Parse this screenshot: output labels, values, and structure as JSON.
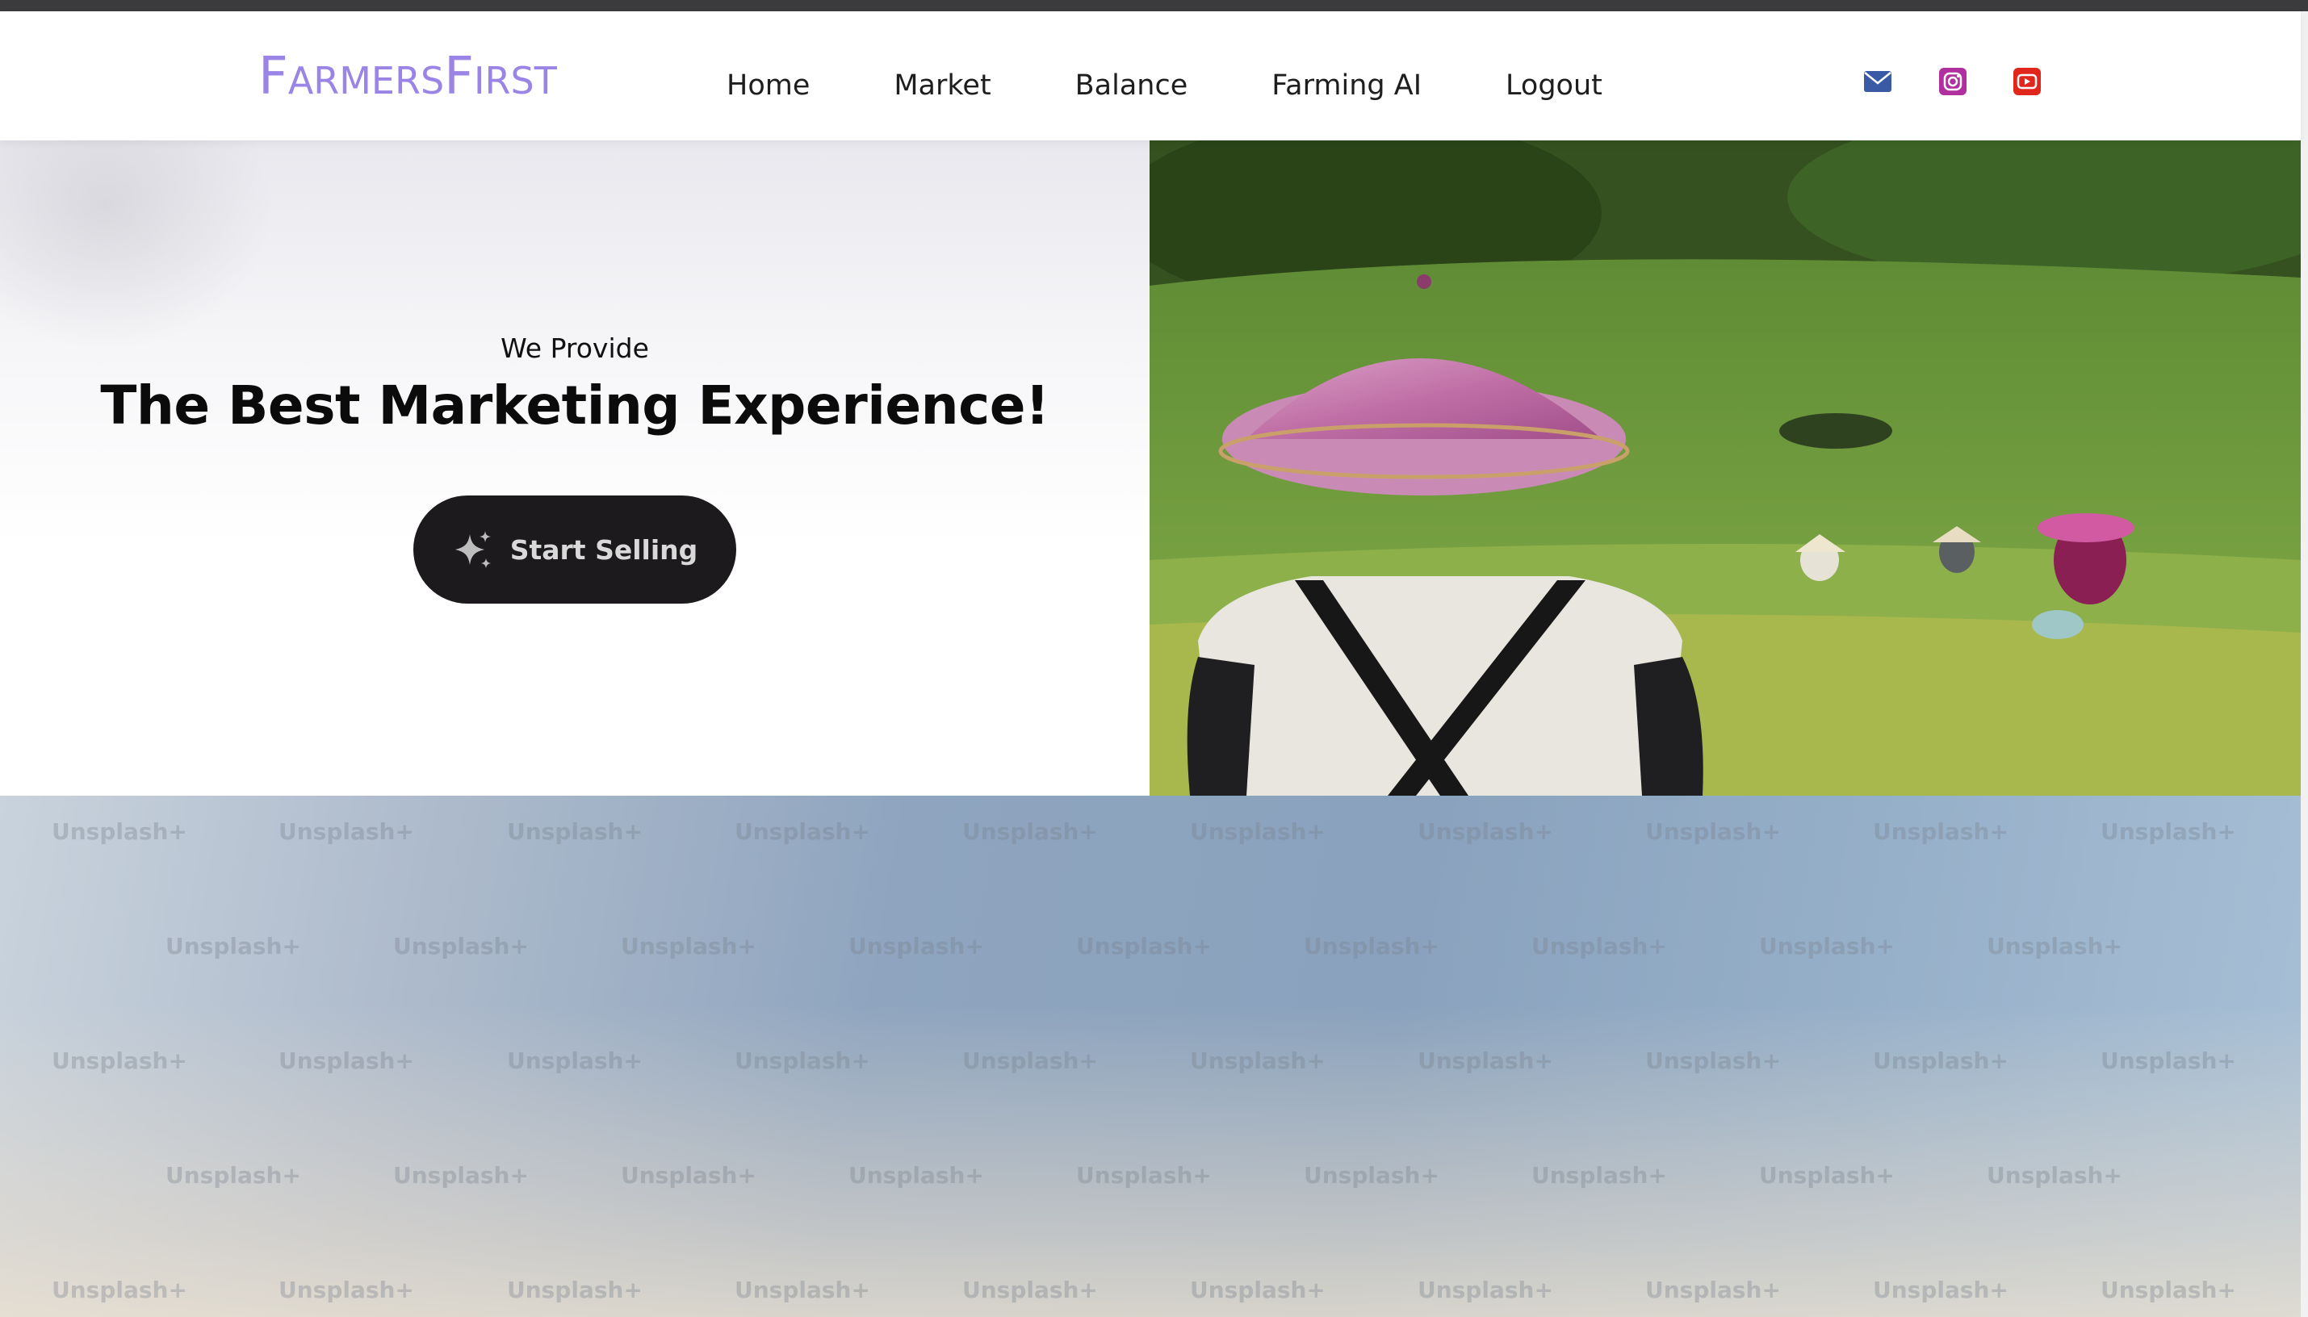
{
  "brand": {
    "name": "FarmersFirst",
    "parts": [
      {
        "text": "F",
        "style": "cap"
      },
      {
        "text": "ARMERS",
        "style": "sc"
      },
      {
        "text": "F",
        "style": "cap"
      },
      {
        "text": "IRST",
        "style": "sc"
      }
    ],
    "color": "#9a84e6"
  },
  "nav": {
    "items": [
      {
        "label": "Home"
      },
      {
        "label": "Market"
      },
      {
        "label": "Balance"
      },
      {
        "label": "Farming AI"
      },
      {
        "label": "Logout"
      }
    ]
  },
  "social": [
    {
      "icon": "mail-icon",
      "color": "#3b5aa5"
    },
    {
      "icon": "instagram-icon",
      "color": "#b1309f"
    },
    {
      "icon": "youtube-icon",
      "color": "#e1261c"
    }
  ],
  "hero": {
    "subtitle": "We Provide",
    "title": "The Best Marketing Experience!",
    "cta_label": "Start Selling",
    "cta_icon": "sparkle-icon",
    "image": "farm-workers-photo"
  },
  "background": {
    "image": "sky-photo",
    "watermark_text": "Unsplash+"
  }
}
